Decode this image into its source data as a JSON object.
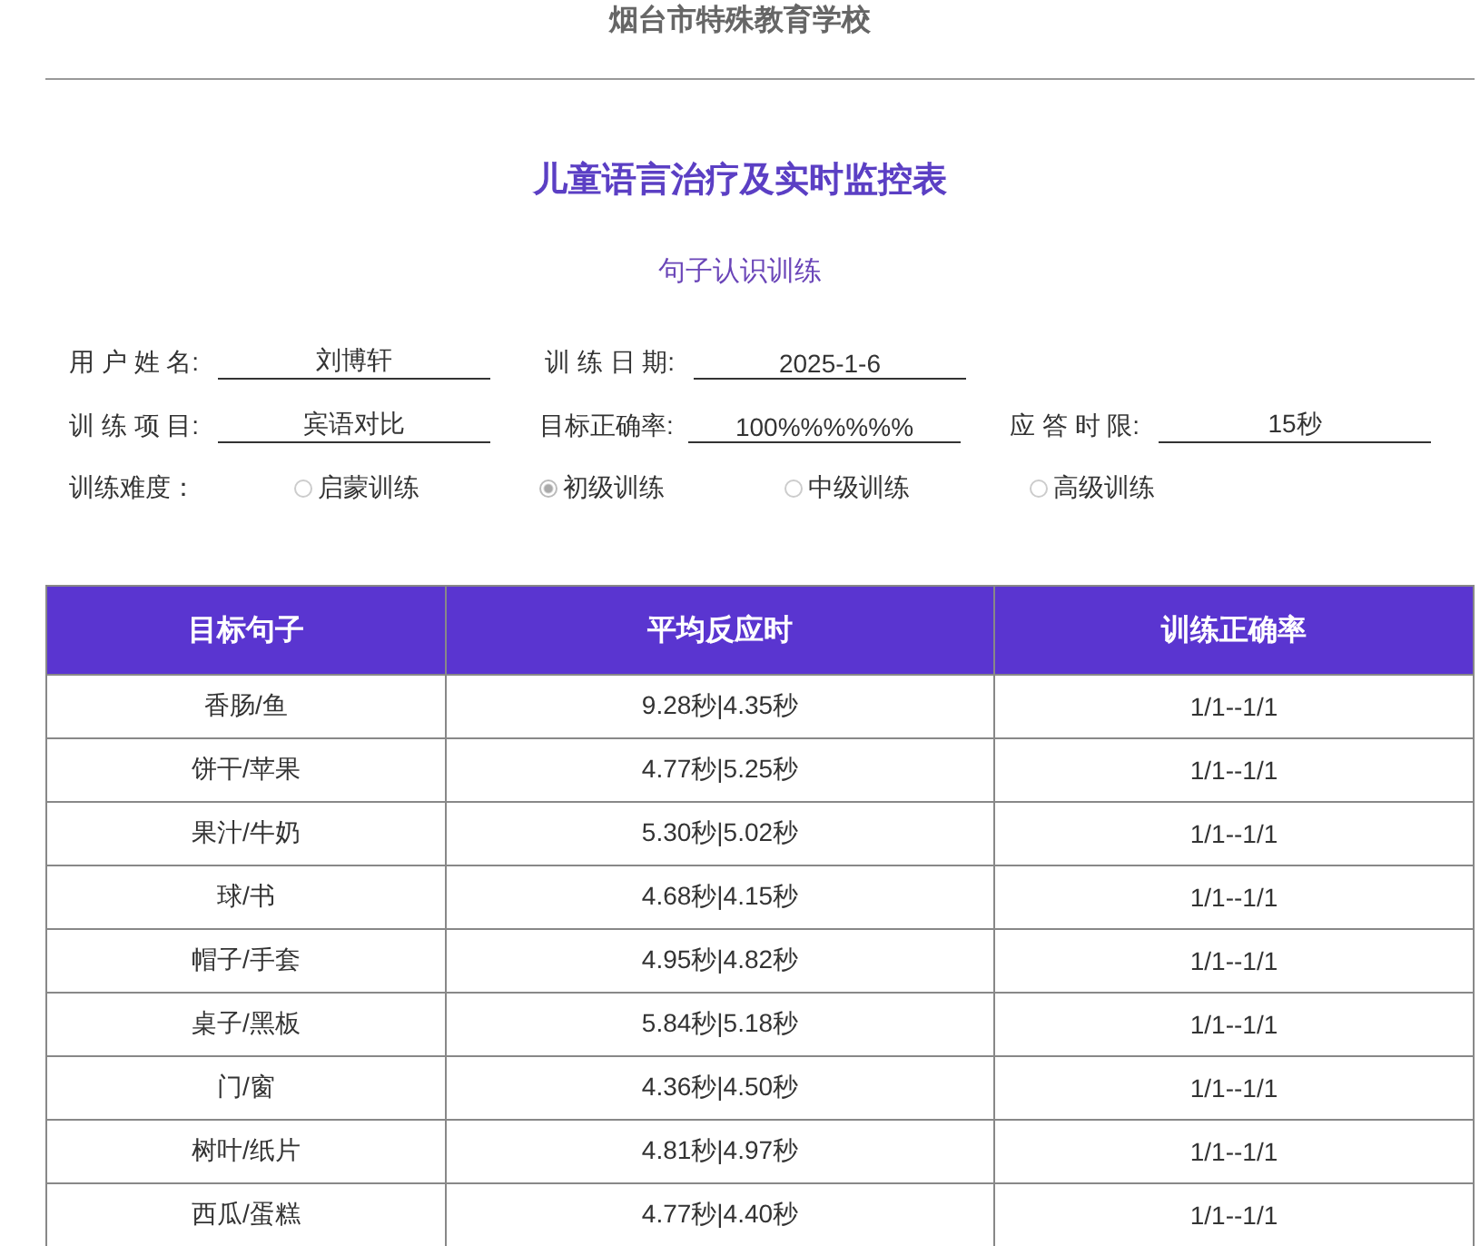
{
  "school": "烟台市特殊教育学校",
  "title": "儿童语言治疗及实时监控表",
  "subtitle": "句子认识训练",
  "form_rows": [
    {
      "fields": [
        {
          "label": "用 户 姓 名:",
          "value": "刘博轩"
        },
        {
          "label": "训 练 日 期:",
          "value": "2025-1-6"
        }
      ]
    },
    {
      "fields": [
        {
          "label": "训 练 项 目:",
          "value": "宾语对比"
        },
        {
          "label": "目标正确率:",
          "value": "100%%%%%%"
        },
        {
          "label": "应 答 时 限:",
          "value": "15秒"
        }
      ]
    }
  ],
  "difficulty": {
    "label": "训练难度：",
    "options": [
      {
        "label": "启蒙训练",
        "selected": false
      },
      {
        "label": "初级训练",
        "selected": true
      },
      {
        "label": "中级训练",
        "selected": false
      },
      {
        "label": "高级训练",
        "selected": false
      }
    ]
  },
  "table": {
    "columns": [
      "目标句子",
      "平均反应时",
      "训练正确率"
    ],
    "rows": [
      [
        "香肠/鱼",
        "9.28秒|4.35秒",
        "1/1--1/1"
      ],
      [
        "饼干/苹果",
        "4.77秒|5.25秒",
        "1/1--1/1"
      ],
      [
        "果汁/牛奶",
        "5.30秒|5.02秒",
        "1/1--1/1"
      ],
      [
        "球/书",
        "4.68秒|4.15秒",
        "1/1--1/1"
      ],
      [
        "帽子/手套",
        "4.95秒|4.82秒",
        "1/1--1/1"
      ],
      [
        "桌子/黑板",
        "5.84秒|5.18秒",
        "1/1--1/1"
      ],
      [
        "门/窗",
        "4.36秒|4.50秒",
        "1/1--1/1"
      ],
      [
        "树叶/纸片",
        "4.81秒|4.97秒",
        "1/1--1/1"
      ],
      [
        "西瓜/蛋糕",
        "4.77秒|4.40秒",
        "1/1--1/1"
      ]
    ]
  }
}
